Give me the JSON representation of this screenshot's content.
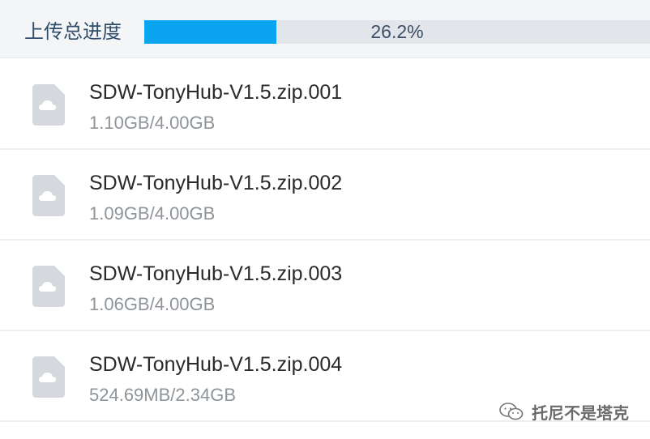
{
  "header": {
    "title": "上传总进度",
    "progress_fraction": 0.262,
    "progress_label": "26.2%"
  },
  "files": [
    {
      "name": "SDW-TonyHub-V1.5.zip.001",
      "size": "1.10GB/4.00GB",
      "icon": "cloud-file-icon"
    },
    {
      "name": "SDW-TonyHub-V1.5.zip.002",
      "size": "1.09GB/4.00GB",
      "icon": "cloud-file-icon"
    },
    {
      "name": "SDW-TonyHub-V1.5.zip.003",
      "size": "1.06GB/4.00GB",
      "icon": "cloud-file-icon"
    },
    {
      "name": "SDW-TonyHub-V1.5.zip.004",
      "size": "524.69MB/2.34GB",
      "icon": "cloud-file-icon"
    }
  ],
  "watermark": {
    "text": "托尼不是塔克",
    "icon": "wechat-icon"
  },
  "colors": {
    "accent": "#0aa4f0",
    "track": "#e2e5ea",
    "header_bg": "#f4f5f7",
    "file_icon": "#d5d8dc"
  }
}
